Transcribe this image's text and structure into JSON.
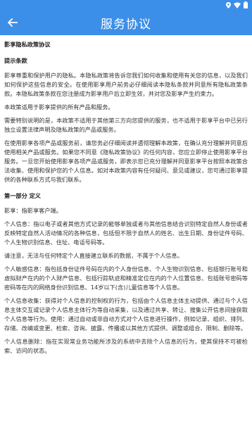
{
  "app_bar": {
    "title": "服务协议",
    "back_icon": "arrow-left-icon",
    "color": "#3b8fe8"
  },
  "status_bar": {
    "icons": [
      "location-icon",
      "wifi-icon",
      "battery-icon"
    ]
  },
  "document": {
    "title": "影享隐私政策协议",
    "sections": [
      {
        "heading": "提示条款",
        "paragraphs": [
          "影享尊重和保护用户的隐私。本隐私政策将告诉您我们如何收集和使用有关您的信息，以及我们如何保护这些信息的安全。在使用影享用户前务必仔细阅读本隐私条款并同意所有隐私政策条款。本隐私政策条款在您注册成为影享用户后立即生效，并对您及影享产生约束力。",
          "本政策适用于影享提供的所有产品和服务。",
          "需要特别说明的是，本政策不适用于其他第三方向您提供的服务，也不适用于影享平台中已另行独立设置法律声明及隐私政策的产品或服务。",
          "在使用影享各项产品或服务前，请您务必仔细阅读并透彻理解本政策，在确认充分理解并同意后使用相关产品或服务。如果您不同意《隐私政策协议》的任何内容，您应立即停止使用影享平台服务。一旦您开始使用影享各项产品或服务，即表示您已充分理解并同意影享平台按照本政策合法收集、使用和保护您的个人信息。如对本政策内容有任何疑问、意见或建议，您可通过影享提供的各种联系方式与我们联系。"
        ]
      },
      {
        "heading": "第一部分 定义",
        "paragraphs": [
          "影享：指影享客户端。",
          "个人信息：指以电子或者其他方式记录的能够单独或者与其他信息结合识别特定自然人身份或者反映特定自然人活动情况的各种信息，包括但不限于自然人的姓名、出生日期、身份证件号码、个人生物识别信息、住址、电话号码等。",
          "请注意，无法与任何特定个人直接建立联系的数据，不属于个人信息。",
          "个人敏感信息：指包括身份证件号码在内的个人身份信息、个人生物识别信息、包括银行账号和虚拟财产在内的个人财产信息、包括行踪轨迹和精准定位在内的个人位置信息、包括账号密码等密码等在内的网络身份识别信息、14岁以下(含)儿童信息等个人信息。",
          "个人信息收集：获得对个人信息的控制权的行为，包括由个人信息主体主动提供、通过与个人信息主体交互或记录个人信息主体行为等自动采集，以及通过共享、转让、搜集公开信息间接获取个人信息等行为。使用：通过自动或非自动方式对个人信息进行操作，例如记录、组织、排列、存储、改编或变更、检索、咨询、披露、传播或以其他方式提供、调整或组合、限制、删除等。",
          "个人信息删除：指在实现常业务功能所涉及的系统中去除个人信息的行为，使其保持不可被检索、访问的状态。"
        ]
      }
    ]
  }
}
